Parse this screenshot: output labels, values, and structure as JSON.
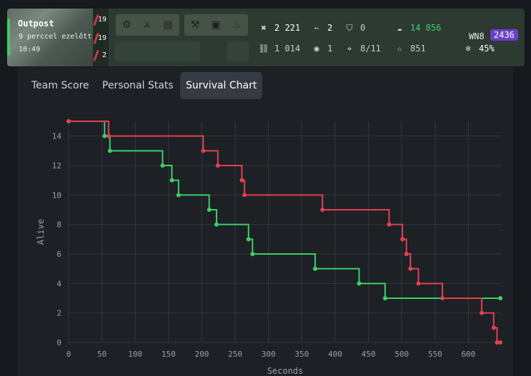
{
  "header": {
    "map_name": "Outpost",
    "time_ago": "9 perccel ezelőtt",
    "clock": "10:49",
    "tiers": [
      "19",
      "19",
      "2"
    ],
    "equipment_icons": [
      "wheel-icon",
      "rifle-icon",
      "radio-icon"
    ],
    "consumable_icons": [
      "toolbox-icon",
      "ammo-crate-icon",
      "fire-extinguisher-icon"
    ],
    "stats": {
      "damage": "2 221",
      "kills": "2",
      "blocked": "0",
      "assist": "1 014",
      "spotted": "1",
      "hits": "8/11",
      "xp": "851",
      "credits": "14 856",
      "wn8_label": "WN8",
      "wn8": "2436",
      "winrate": "45%"
    },
    "colors": {
      "accent_green": "#3ccf68",
      "wn8_purple": "#6a40c8"
    }
  },
  "tabs": [
    {
      "label": "Team Score",
      "active": false
    },
    {
      "label": "Personal Stats",
      "active": false
    },
    {
      "label": "Survival Chart",
      "active": true
    }
  ],
  "chart_data": {
    "type": "line",
    "step": true,
    "xlabel": "Seconds",
    "ylabel": "Alive",
    "xlim": [
      0,
      650
    ],
    "ylim": [
      0,
      15
    ],
    "xticks": [
      0,
      50,
      100,
      150,
      200,
      250,
      300,
      350,
      400,
      450,
      500,
      550,
      600
    ],
    "yticks": [
      0,
      2,
      4,
      6,
      8,
      10,
      12,
      14
    ],
    "grid": true,
    "series": [
      {
        "color": "#3ccf68",
        "points": [
          [
            0,
            15
          ],
          [
            54,
            14
          ],
          [
            62,
            13
          ],
          [
            141,
            12
          ],
          [
            155,
            11
          ],
          [
            165,
            10
          ],
          [
            211,
            9
          ],
          [
            222,
            8
          ],
          [
            270,
            7
          ],
          [
            276,
            6
          ],
          [
            370,
            5
          ],
          [
            436,
            4
          ],
          [
            475,
            3
          ],
          [
            648,
            3
          ]
        ]
      },
      {
        "color": "#e0414f",
        "points": [
          [
            0,
            15
          ],
          [
            60,
            14
          ],
          [
            202,
            13
          ],
          [
            224,
            12
          ],
          [
            260,
            11
          ],
          [
            264,
            10
          ],
          [
            381,
            9
          ],
          [
            481,
            8
          ],
          [
            501,
            7
          ],
          [
            507,
            6
          ],
          [
            513,
            5
          ],
          [
            525,
            4
          ],
          [
            561,
            3
          ],
          [
            620,
            2
          ],
          [
            638,
            1
          ],
          [
            643,
            0
          ],
          [
            648,
            0
          ]
        ]
      }
    ]
  }
}
